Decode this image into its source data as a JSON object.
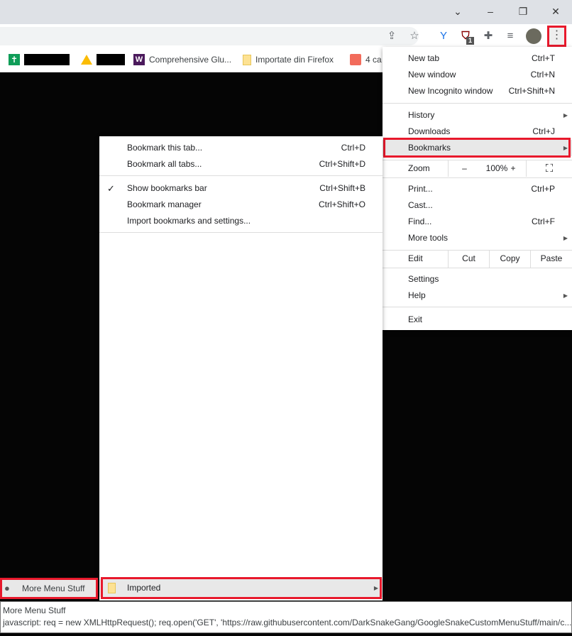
{
  "window": {
    "controls": [
      "⌄",
      "–",
      "❐",
      "✕"
    ]
  },
  "toolbar": {
    "icons": [
      "share-icon",
      "star-icon",
      "extension-y-icon",
      "ublock-icon",
      "puzzle-icon",
      "media-icon",
      "avatar",
      "kebab-menu-icon"
    ],
    "ublock_badge": "1"
  },
  "bookmarks_bar": {
    "items": [
      {
        "label": "Comprehensive Glu..."
      },
      {
        "label": "Importate din Firefox"
      },
      {
        "label": "4 ca"
      }
    ]
  },
  "chrome_menu": {
    "new_tab": "New tab",
    "new_tab_sc": "Ctrl+T",
    "new_window": "New window",
    "new_window_sc": "Ctrl+N",
    "incognito": "New Incognito window",
    "incognito_sc": "Ctrl+Shift+N",
    "history": "History",
    "downloads": "Downloads",
    "downloads_sc": "Ctrl+J",
    "bookmarks": "Bookmarks",
    "zoom": "Zoom",
    "zoom_minus": "–",
    "zoom_value": "100%",
    "zoom_plus": "+",
    "print": "Print...",
    "print_sc": "Ctrl+P",
    "cast": "Cast...",
    "find": "Find...",
    "find_sc": "Ctrl+F",
    "more_tools": "More tools",
    "edit": "Edit",
    "cut": "Cut",
    "copy": "Copy",
    "paste": "Paste",
    "settings": "Settings",
    "help": "Help",
    "exit": "Exit"
  },
  "bookmarks_menu": {
    "bookmark_tab": "Bookmark this tab...",
    "bookmark_tab_sc": "Ctrl+D",
    "bookmark_all": "Bookmark all tabs...",
    "bookmark_all_sc": "Ctrl+Shift+D",
    "show_bar": "Show bookmarks bar",
    "show_bar_sc": "Ctrl+Shift+B",
    "show_bar_checked": true,
    "manager": "Bookmark manager",
    "manager_sc": "Ctrl+Shift+O",
    "import": "Import bookmarks and settings...",
    "imported": "Imported"
  },
  "bookmarklet": {
    "label": "More Menu Stuff"
  },
  "tooltip": {
    "title": "More Menu Stuff",
    "url": "javascript: req = new XMLHttpRequest(); req.open('GET', 'https://raw.githubusercontent.com/DarkSnakeGang/GoogleSnakeCustomMenuStuff/main/c..."
  },
  "colors": {
    "highlight": "#e8192c",
    "menu_hover": "#e8e8e8"
  }
}
